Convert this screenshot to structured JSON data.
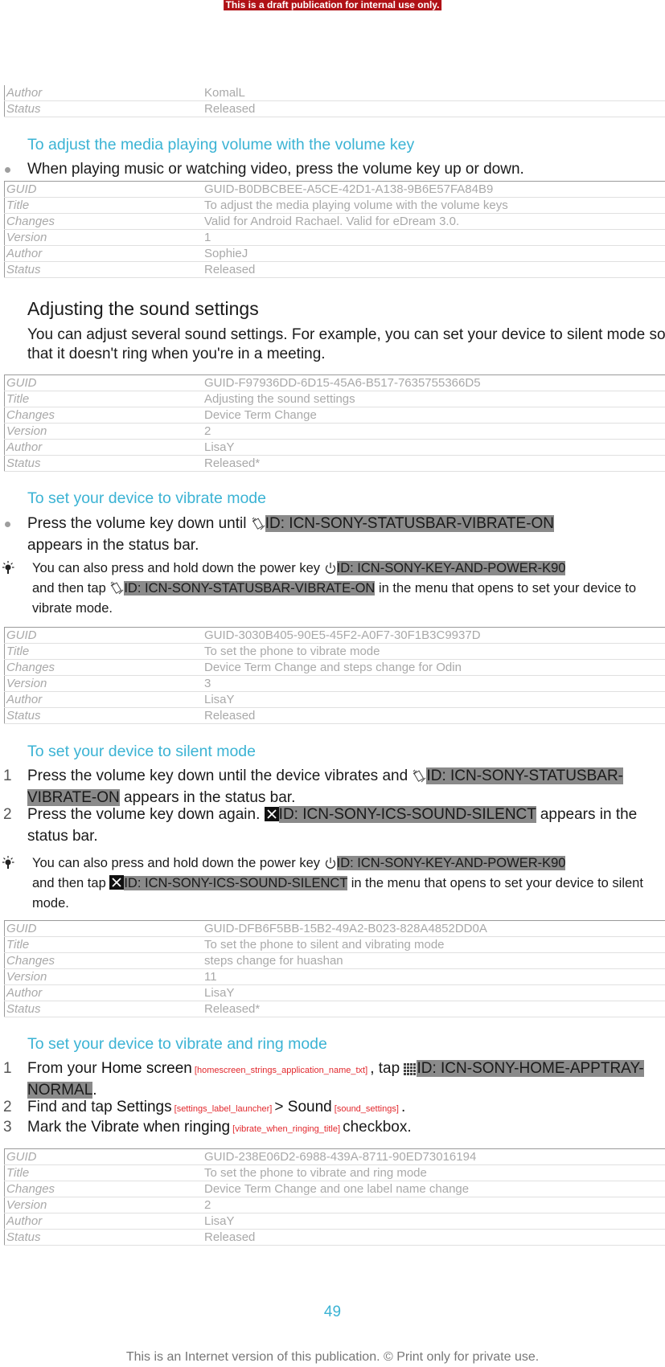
{
  "banner": "This is a draft publication for internal use only.",
  "top_table": [
    {
      "key": "Author",
      "value": "KomalL"
    },
    {
      "key": "Status",
      "value": "Released"
    }
  ],
  "sections": {
    "volume_key": {
      "heading": "To adjust the media playing volume with the volume key",
      "bullet": "When playing music or watching video, press the volume key up or down.",
      "meta": [
        {
          "key": "GUID",
          "value": "GUID-B0DBCBEE-A5CE-42D1-A138-9B6E57FA84B9"
        },
        {
          "key": "Title",
          "value": "To adjust the media playing volume with the volume keys"
        },
        {
          "key": "Changes",
          "value": "Valid for Android Rachael. Valid for eDream 3.0."
        },
        {
          "key": "Version",
          "value": "1"
        },
        {
          "key": "Author",
          "value": "SophieJ"
        },
        {
          "key": "Status",
          "value": "Released"
        }
      ]
    },
    "sound_settings": {
      "heading": "Adjusting the sound settings",
      "paragraph": "You can adjust several sound settings. For example, you can set your device to silent mode so that it doesn't ring when you're in a meeting.",
      "meta": [
        {
          "key": "GUID",
          "value": "GUID-F97936DD-6D15-45A6-B517-7635755366D5"
        },
        {
          "key": "Title",
          "value": "Adjusting the sound settings"
        },
        {
          "key": "Changes",
          "value": "Device Term Change"
        },
        {
          "key": "Version",
          "value": "2"
        },
        {
          "key": "Author",
          "value": "LisaY"
        },
        {
          "key": "Status",
          "value": "Released*"
        }
      ]
    },
    "vibrate_mode": {
      "heading": "To set your device to vibrate mode",
      "bullet_pre": "Press the volume key down until ",
      "bullet_id": "ID: ICN-SONY-STATUSBAR-VIBRATE-ON",
      "bullet_post": "appears in the status bar.",
      "tip_pre": "You can also press and hold down the power key ",
      "tip_id1": "ID: ICN-SONY-KEY-AND-POWER-K90",
      "tip_mid": " and then tap ",
      "tip_id2": "ID: ICN-SONY-STATUSBAR-VIBRATE-ON",
      "tip_post": " in the menu that opens to set your device to vibrate mode.",
      "meta": [
        {
          "key": "GUID",
          "value": "GUID-3030B405-90E5-45F2-A0F7-30F1B3C9937D"
        },
        {
          "key": "Title",
          "value": "To set the phone to vibrate mode"
        },
        {
          "key": "Changes",
          "value": "Device Term Change and steps change for Odin"
        },
        {
          "key": "Version",
          "value": "3"
        },
        {
          "key": "Author",
          "value": "LisaY"
        },
        {
          "key": "Status",
          "value": "Released"
        }
      ]
    },
    "silent_mode": {
      "heading": "To set your device to silent mode",
      "steps": [
        {
          "num": "1",
          "pre": "Press the volume key down until the device vibrates and ",
          "id": "ID: ICN-SONY-STATUSBAR-VIBRATE-ON",
          "post": " appears in the status bar."
        },
        {
          "num": "2",
          "pre": "Press the volume key down again. ",
          "id": "ID: ICN-SONY-ICS-SOUND-SILENCT",
          "post": " appears in the status bar."
        }
      ],
      "tip_pre": "You can also press and hold down the power key ",
      "tip_id1": "ID: ICN-SONY-KEY-AND-POWER-K90",
      "tip_mid": " and then tap ",
      "tip_id2": "ID: ICN-SONY-ICS-SOUND-SILENCT",
      "tip_post": " in the menu that opens to set your device to silent mode.",
      "meta": [
        {
          "key": "GUID",
          "value": "GUID-DFB6F5BB-15B2-49A2-B023-828A4852DD0A"
        },
        {
          "key": "Title",
          "value": "To set the phone to silent and vibrating mode"
        },
        {
          "key": "Changes",
          "value": "steps change for huashan"
        },
        {
          "key": "Version",
          "value": "11"
        },
        {
          "key": "Author",
          "value": "LisaY"
        },
        {
          "key": "Status",
          "value": "Released*"
        }
      ]
    },
    "vibrate_ring": {
      "heading": "To set your device to vibrate and ring mode",
      "step1": {
        "num": "1",
        "pre": "From your ",
        "ui": "Home screen",
        "tag": " [homescreen_strings_application_name_txt] ",
        "mid": ", tap ",
        "id": "ID: ICN-SONY-HOME-APPTRAY-NORMAL",
        "post": "."
      },
      "step2": {
        "num": "2",
        "pre": "Find and tap ",
        "ui1": "Settings",
        "tag1": " [settings_label_launcher] ",
        "sep": "> ",
        "ui2": "Sound",
        "tag2": " [sound_settings] ",
        "post": "."
      },
      "step3": {
        "num": "3",
        "pre": "Mark the ",
        "ui": "Vibrate when ringing",
        "tag": " [vibrate_when_ringing_title] ",
        "post": "checkbox."
      },
      "meta": [
        {
          "key": "GUID",
          "value": "GUID-238E06D2-6988-439A-8711-90ED73016194"
        },
        {
          "key": "Title",
          "value": "To set the phone to vibrate and ring mode"
        },
        {
          "key": "Changes",
          "value": "Device Term Change and one label name change"
        },
        {
          "key": "Version",
          "value": "2"
        },
        {
          "key": "Author",
          "value": "LisaY"
        },
        {
          "key": "Status",
          "value": "Released"
        }
      ]
    }
  },
  "page_number": "49",
  "footer": "This is an Internet version of this publication. © Print only for private use."
}
